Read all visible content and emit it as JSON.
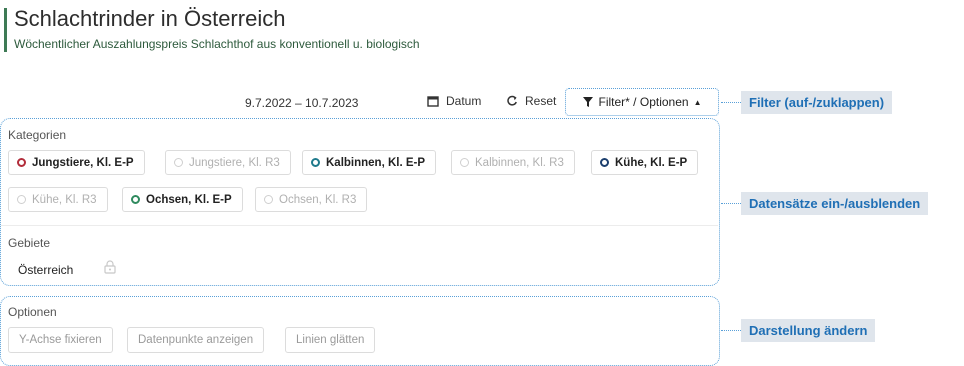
{
  "header": {
    "title": "Schlachtrinder in Österreich",
    "subtitle": "Wöchentlicher Auszahlungspreis Schlachthof aus konventionell u. biologisch"
  },
  "toolbar": {
    "date_range": "9.7.2022 – 10.7.2023",
    "date_label": "Datum",
    "reset_label": "Reset",
    "filter_label": "Filter* / Optionen"
  },
  "categories": {
    "label": "Kategorien",
    "chips": [
      {
        "label": "Jungstiere, Kl. E-P",
        "active": true,
        "color": "#b22d3b"
      },
      {
        "label": "Jungstiere, Kl. R3",
        "active": false,
        "color": "#cfcfcf"
      },
      {
        "label": "Kalbinnen, Kl. E-P",
        "active": true,
        "color": "#1f7a8c"
      },
      {
        "label": "Kalbinnen, Kl. R3",
        "active": false,
        "color": "#cfcfcf"
      },
      {
        "label": "Kühe, Kl. E-P",
        "active": true,
        "color": "#1c3f6e"
      },
      {
        "label": "Kühe, Kl. R3",
        "active": false,
        "color": "#cfcfcf"
      },
      {
        "label": "Ochsen, Kl. E-P",
        "active": true,
        "color": "#2f8a5e"
      },
      {
        "label": "Ochsen, Kl. R3",
        "active": false,
        "color": "#cfcfcf"
      }
    ]
  },
  "regions": {
    "label": "Gebiete",
    "selected": "Österreich"
  },
  "options": {
    "label": "Optionen",
    "buttons": [
      "Y-Achse fixieren",
      "Datenpunkte anzeigen",
      "Linien glätten"
    ]
  },
  "annotations": {
    "filter": "Filter (auf-/zuklappen)",
    "datasets": "Datensätze ein-/ausblenden",
    "display": "Darstellung ändern"
  },
  "colors": {
    "accent_green": "#3e7a55",
    "annotation_blue": "#1f6fb5",
    "dotted_border": "#5aa0d8"
  }
}
